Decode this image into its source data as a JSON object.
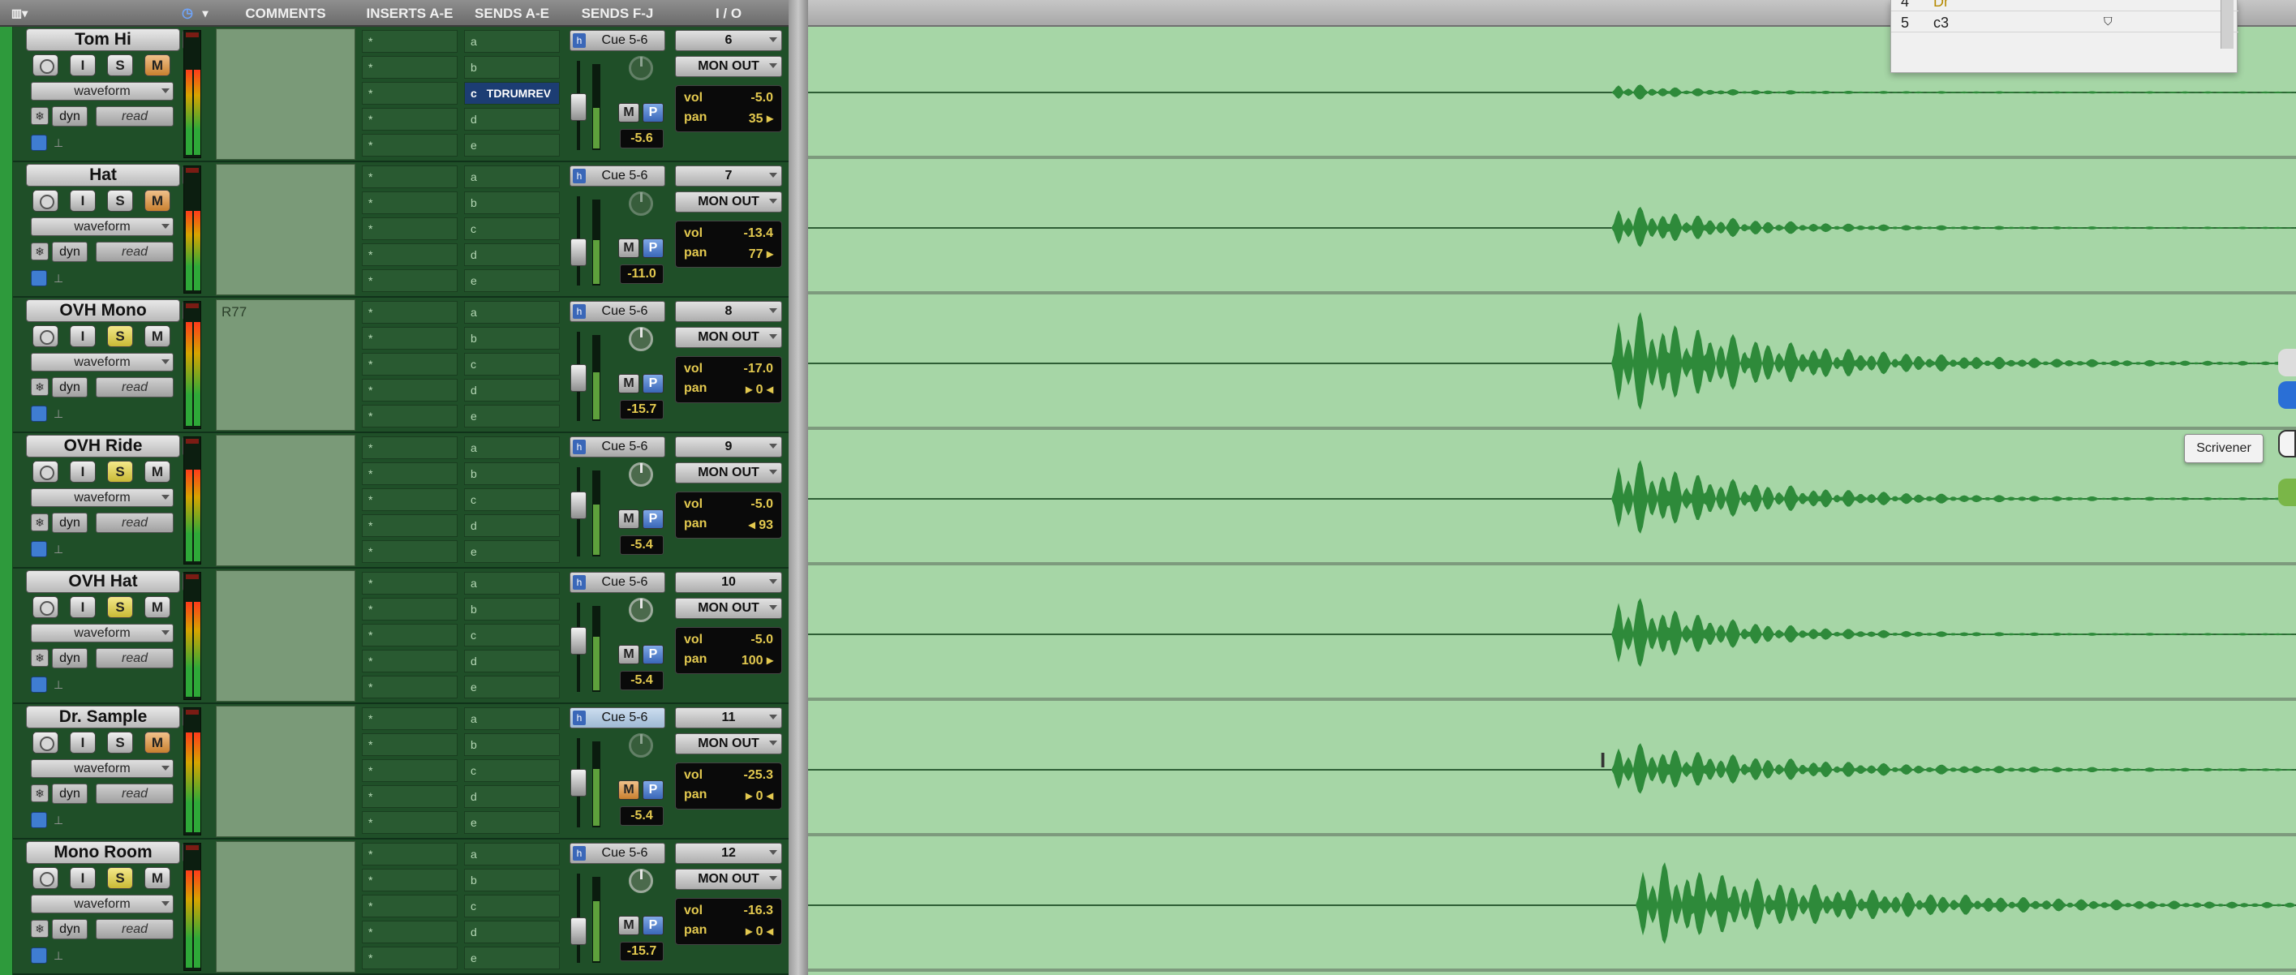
{
  "header": {
    "comments": "COMMENTS",
    "inserts": "INSERTS A-E",
    "sends_ae": "SENDS A-E",
    "sends_fj": "SENDS F-J",
    "io": "I / O"
  },
  "tracks": [
    {
      "name": "Tom Hi",
      "comment": "",
      "send_active": "TDRUMREV",
      "cue": "Cue 5-6",
      "input": "6",
      "output": "MON OUT",
      "vol": "-5.0",
      "pan": "35 ▸",
      "fader_db": "-5.6",
      "solo": false,
      "mon": true,
      "cue_hl": false,
      "m_on": false
    },
    {
      "name": "Hat",
      "comment": "",
      "send_active": "",
      "cue": "Cue 5-6",
      "input": "7",
      "output": "MON OUT",
      "vol": "-13.4",
      "pan": "77 ▸",
      "fader_db": "-11.0",
      "solo": false,
      "mon": true,
      "cue_hl": false,
      "m_on": false
    },
    {
      "name": "OVH Mono",
      "comment": "R77",
      "send_active": "",
      "cue": "Cue 5-6",
      "input": "8",
      "output": "MON OUT",
      "vol": "-17.0",
      "pan": "▸ 0 ◂",
      "fader_db": "-15.7",
      "solo": true,
      "mon": false,
      "cue_hl": false,
      "m_on": false
    },
    {
      "name": "OVH Ride",
      "comment": "",
      "send_active": "",
      "cue": "Cue 5-6",
      "input": "9",
      "output": "MON OUT",
      "vol": "-5.0",
      "pan": "◂ 93",
      "fader_db": "-5.4",
      "solo": true,
      "mon": false,
      "cue_hl": false,
      "m_on": false
    },
    {
      "name": "OVH Hat",
      "comment": "",
      "send_active": "",
      "cue": "Cue 5-6",
      "input": "10",
      "output": "MON OUT",
      "vol": "-5.0",
      "pan": "100 ▸",
      "fader_db": "-5.4",
      "solo": true,
      "mon": false,
      "cue_hl": false,
      "m_on": false
    },
    {
      "name": "Dr. Sample",
      "comment": "",
      "send_active": "",
      "cue": "Cue 5-6",
      "input": "11",
      "output": "MON OUT",
      "vol": "-25.3",
      "pan": "▸ 0 ◂",
      "fader_db": "-5.4",
      "solo": false,
      "mon": true,
      "cue_hl": true,
      "m_on": true
    },
    {
      "name": "Mono Room",
      "comment": "",
      "send_active": "",
      "cue": "Cue 5-6",
      "input": "12",
      "output": "MON OUT",
      "vol": "-16.3",
      "pan": "▸ 0 ◂",
      "fader_db": "-15.7",
      "solo": true,
      "mon": false,
      "cue_hl": false,
      "m_on": false
    }
  ],
  "strip_labels": {
    "insert_slot": "*",
    "send_slots": [
      "a",
      "b",
      "c",
      "d",
      "e"
    ],
    "send_active_letter": "c",
    "view": "waveform",
    "dyn": "dyn",
    "automation": "read",
    "rec_btn": "",
    "input_btn": "I",
    "solo_btn": "S",
    "mute_btn": "M",
    "m_btn": "M",
    "p_btn": "P",
    "vol_label": "vol",
    "pan_label": "pan",
    "cue_h": "h"
  },
  "popup": {
    "rows": [
      {
        "num": "4",
        "name": "Dr"
      },
      {
        "num": "5",
        "name": "c3"
      }
    ]
  },
  "tooltip": "Scrivener",
  "colors": {
    "track_bg": "#1f4f28",
    "edit_bg": "#a6d6a6",
    "waveform": "#2e8a3a",
    "solo_on": "#e8d85a",
    "mute_on": "#d18a3a"
  }
}
